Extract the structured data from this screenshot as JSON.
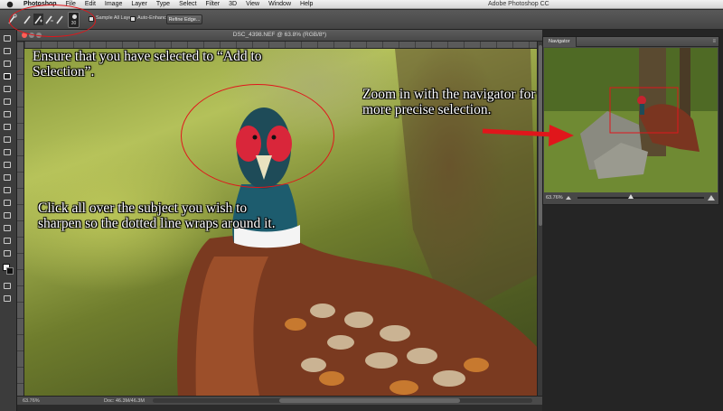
{
  "menubar": {
    "app": "Photoshop",
    "menus": [
      "File",
      "Edit",
      "Image",
      "Layer",
      "Type",
      "Select",
      "Filter",
      "3D",
      "View",
      "Window",
      "Help"
    ],
    "window_title": "Adobe Photoshop CC"
  },
  "options_bar": {
    "brush_size": "30",
    "sample_all_layers": "Sample All Layers",
    "auto_enhance": "Auto-Enhance",
    "refine_edge": "Refine Edge..."
  },
  "document": {
    "tab_title": "DSC_4398.NEF @ 63.8% (RGB/8*)",
    "status_zoom": "63.76%",
    "status_doc": "Doc: 46.3M/46.3M"
  },
  "navigator": {
    "tab_label": "Navigator",
    "zoom_value": "63.76%"
  },
  "annotations": {
    "note1": "Ensure that you have selected to “Add to Selection”.",
    "note2": "Click all over the subject you wish to sharpen so the dotted line wraps around it.",
    "note3": "Zoom in with the navigator for more precise selection."
  },
  "colors": {
    "annotation_red": "#e0161b",
    "workspace_bg": "#252525",
    "panel_bg": "#474747"
  }
}
